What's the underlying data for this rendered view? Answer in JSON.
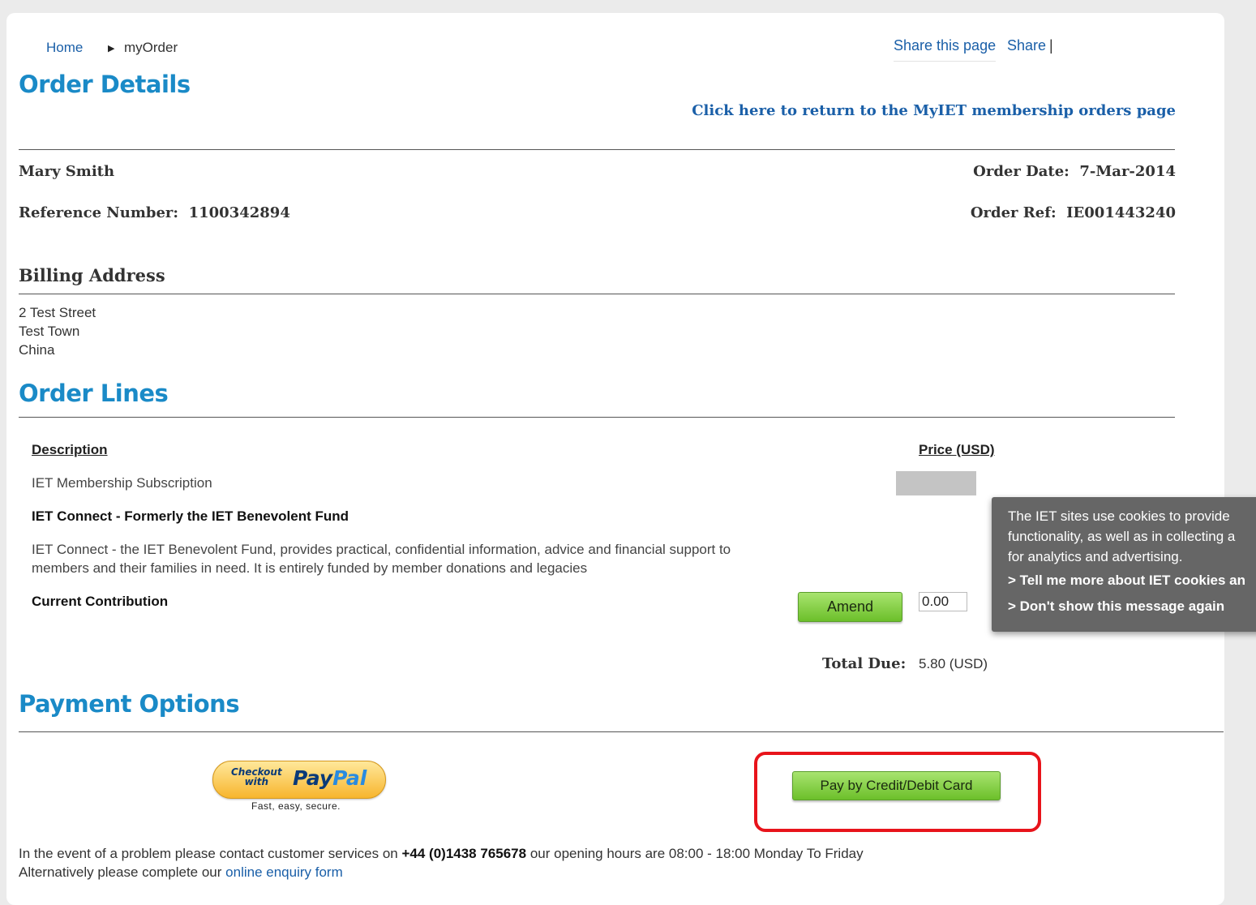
{
  "breadcrumb": {
    "home": "Home",
    "current": "myOrder"
  },
  "share": {
    "link": "Share this page",
    "text": "Share",
    "separator": "|"
  },
  "order_details": {
    "title": "Order Details",
    "return_link": "Click here to return to the MyIET membership orders page",
    "customer_name": "Mary Smith",
    "order_date_label": "Order Date:",
    "order_date": "7-Mar-2014",
    "reference_label": "Reference Number:",
    "reference_number": "1100342894",
    "order_ref_label": "Order Ref:",
    "order_ref": "IE001443240"
  },
  "billing": {
    "title": "Billing Address",
    "lines": [
      "2 Test Street",
      "Test Town",
      "China"
    ]
  },
  "order_lines": {
    "title": "Order Lines",
    "col_description": "Description",
    "col_price": "Price (USD)",
    "item_subscription": "IET Membership Subscription",
    "item_connect_title": "IET Connect - Formerly the IET Benevolent Fund",
    "item_connect_desc": "IET Connect - the IET Benevolent Fund, provides practical, confidential information, advice and financial support to members and their families in need. It is entirely funded by member donations and legacies",
    "contribution_label": "Current Contribution",
    "amend_label": "Amend",
    "contribution_value": "0.00",
    "total_label": "Total Due:",
    "total_value": "5.80 (USD)"
  },
  "cookie_notice": {
    "line1": "The IET sites use cookies to provide",
    "line2": "functionality, as well as in collecting a",
    "line3": "for analytics and advertising.",
    "link_more": "> Tell me more about IET cookies an",
    "link_dismiss": "> Don't show this message again"
  },
  "payment": {
    "title": "Payment Options",
    "paypal_checkout": "Checkout",
    "paypal_with": "with",
    "paypal_pay": "Pay",
    "paypal_pal": "Pal",
    "paypal_tagline": "Fast, easy, secure.",
    "card_button": "Pay by Credit/Debit Card"
  },
  "footer": {
    "line1_prefix": "In the event of a problem please contact customer services on",
    "phone": "+44 (0)1438 765678",
    "line1_suffix": "our opening hours are 08:00 - 18:00 Monday To Friday",
    "line2_prefix": "Alternatively please complete our",
    "enquiry_link": "online enquiry form"
  },
  "colors": {
    "heading_blue": "#1a8ac7",
    "link_blue": "#1a5fa8",
    "button_green": "#8ad24b",
    "highlight_red": "#e8141b",
    "cookie_bg": "#666666"
  }
}
